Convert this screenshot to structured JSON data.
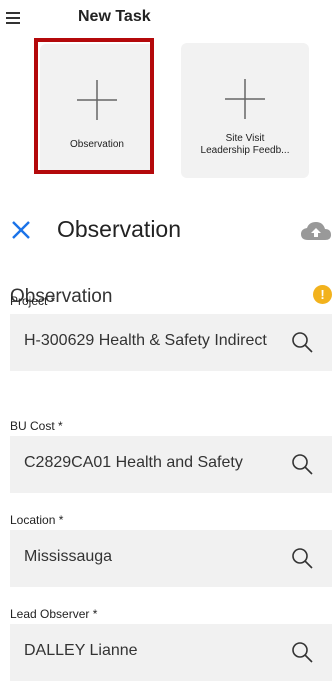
{
  "header": {
    "title": "New Task"
  },
  "tiles": [
    {
      "label": "Observation"
    },
    {
      "label_line1": "Site Visit",
      "label_line2": "Leadership Feedb..."
    }
  ],
  "form": {
    "title": "Observation",
    "section_title": "Observation",
    "alert_symbol": "!",
    "fields": [
      {
        "label": "Project *",
        "value": "H-300629 Health & Safety Indirect"
      },
      {
        "label": "BU Cost *",
        "value": "C2829CA01 Health and Safety"
      },
      {
        "label": "Location *",
        "value": "Mississauga"
      },
      {
        "label": "Lead Observer *",
        "value": "DALLEY Lianne"
      }
    ]
  },
  "colors": {
    "highlight_border": "#b4090b",
    "close_icon": "#1a73e8",
    "alert": "#f2b21d",
    "tile_bg": "#f2f2f2",
    "field_bg": "#f1f1f1"
  }
}
